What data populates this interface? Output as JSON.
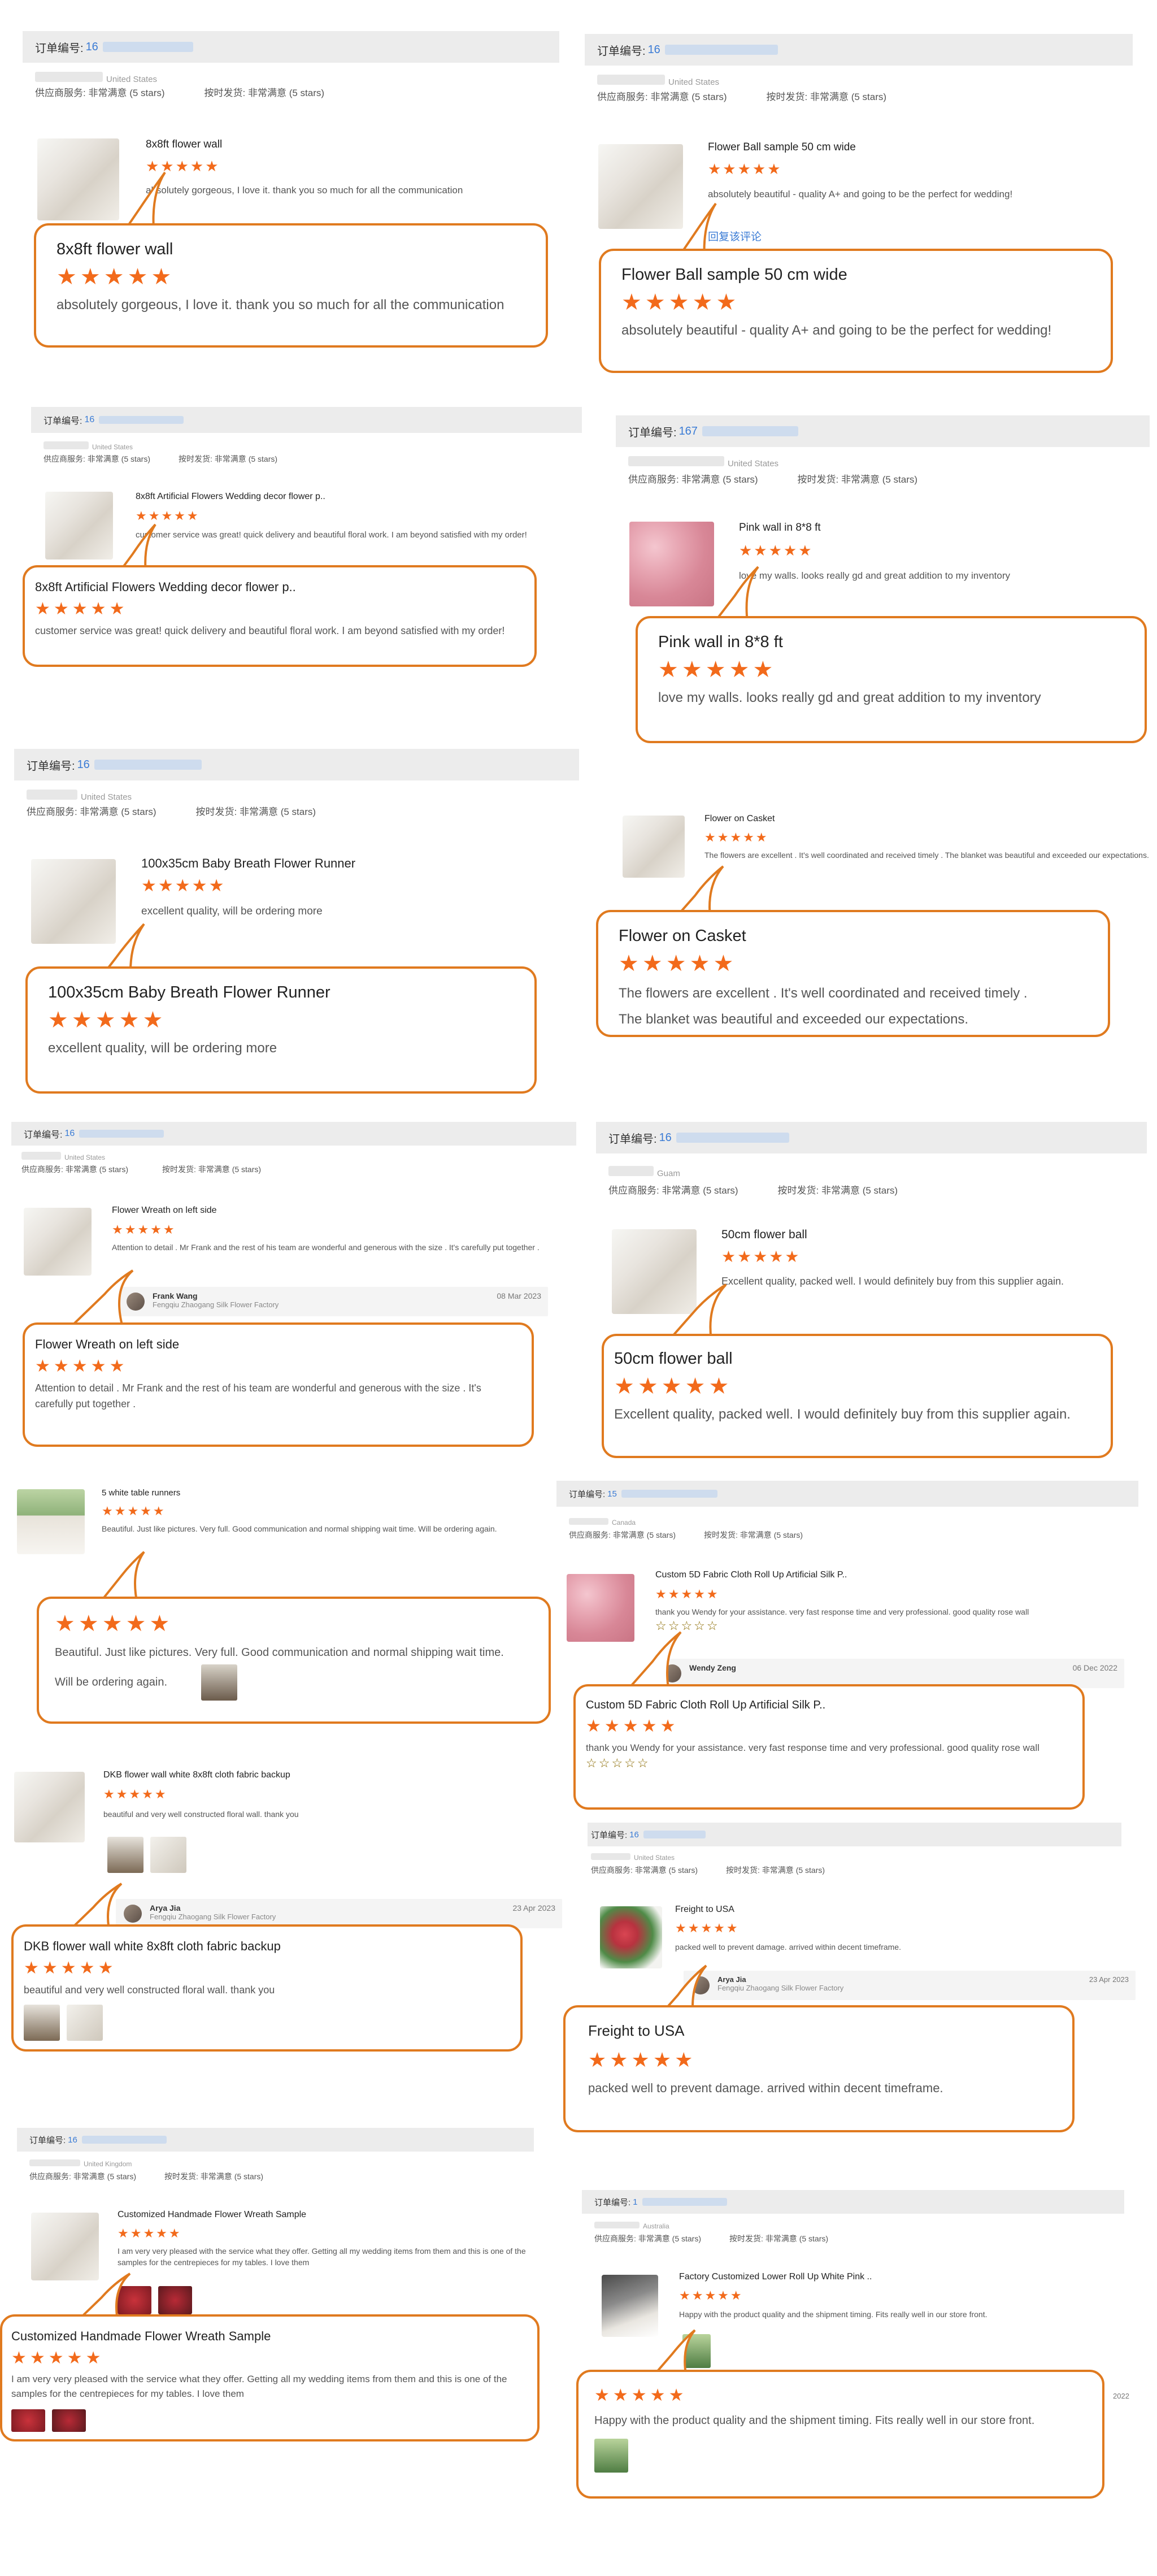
{
  "common": {
    "order_label": "订单编号:",
    "supplier_service": "供应商服务: 非常满意",
    "on_time": "按时发货: 非常满意",
    "stars_note": "(5 stars)",
    "stars": "★★★★★",
    "outline_stars": "☆☆☆☆☆",
    "reply_link": "回复该评论"
  },
  "reviews": [
    {
      "order": "16",
      "country": "United States",
      "title": "8x8ft flower wall",
      "text": "absolutely gorgeous, I love it. thank you so much for all the communication"
    },
    {
      "order": "16",
      "country": "United States",
      "title": "Flower Ball sample 50 cm wide",
      "text": "absolutely beautiful - quality A+ and going to be the perfect for wedding!"
    },
    {
      "order": "16",
      "country": "United States",
      "title": "8x8ft Artificial Flowers Wedding decor flower p..",
      "text": "customer service was great! quick delivery and beautiful floral work. I am beyond satisfied with my order!"
    },
    {
      "order": "167",
      "country": "United States",
      "title": "Pink wall in 8*8 ft",
      "text": "love my walls. looks really gd and great addition to my inventory"
    },
    {
      "order": "16",
      "country": "United States",
      "title": "100x35cm Baby Breath Flower Runner",
      "text": "excellent quality, will be ordering more"
    },
    {
      "order": "",
      "country": "",
      "title": "Flower on Casket",
      "text": "The flowers are excellent . It's well coordinated and received timely . The blanket was beautiful and exceeded our expectations.",
      "text_line1": "The flowers are excellent . It's well coordinated and received timely .",
      "text_line2": "The blanket was beautiful and exceeded our expectations."
    },
    {
      "order": "16",
      "country": "United States",
      "title": "Flower Wreath on left side",
      "text": "Attention to detail . Mr Frank and the rest of his team are wonderful and generous with the size . It's carefully put together .",
      "reply_name": "Frank Wang",
      "reply_company": "Fengqiu Zhaogang Silk Flower Factory",
      "reply_date": "08 Mar 2023"
    },
    {
      "order": "16",
      "country": "Guam",
      "title": "50cm flower ball",
      "text": "Excellent quality, packed well. I would definitely buy from this supplier again."
    },
    {
      "order": "",
      "country": "",
      "title": "5 white table runners",
      "text": "Beautiful. Just like pictures. Very full. Good communication and normal shipping wait time. Will be ordering again.",
      "text_line1": "Beautiful. Just like pictures. Very full. Good communication and normal shipping wait time.",
      "text_line2": "Will be ordering  again."
    },
    {
      "order": "15",
      "country": "Canada",
      "title": "Custom 5D Fabric Cloth Roll Up Artificial Silk P..",
      "text": "thank you Wendy for your assistance. very fast response time and very professional. good quality rose wall",
      "reply_name": "Wendy Zeng",
      "reply_date": "06 Dec 2022"
    },
    {
      "order": "",
      "country": "",
      "title": "DKB flower wall white 8x8ft cloth fabric backup",
      "text": "beautiful and very well constructed floral wall.  thank you",
      "reply_name": "Arya Jia",
      "reply_company": "Fengqiu Zhaogang Silk Flower Factory",
      "reply_date": "23 Apr 2023"
    },
    {
      "order": "16",
      "country": "United States",
      "title": "Freight to USA",
      "text": "packed well to prevent damage. arrived within decent timeframe.",
      "reply_name": "Arya Jia",
      "reply_company": "Fengqiu Zhaogang Silk Flower Factory",
      "reply_date": "23 Apr 2023"
    },
    {
      "order": "16",
      "country": "United Kingdom",
      "title": "Customized Handmade Flower Wreath Sample",
      "text": "I am very very pleased with the service what they offer. Getting all my wedding items from them and this is one of the samples for the centrepieces for my tables. I love them"
    },
    {
      "order": "1",
      "country": "Australia",
      "title": "Factory Customized Lower Roll Up White Pink ..",
      "text": "Happy with the product quality and the shipment timing. Fits really well in our store front.",
      "side_date": "2022"
    }
  ]
}
